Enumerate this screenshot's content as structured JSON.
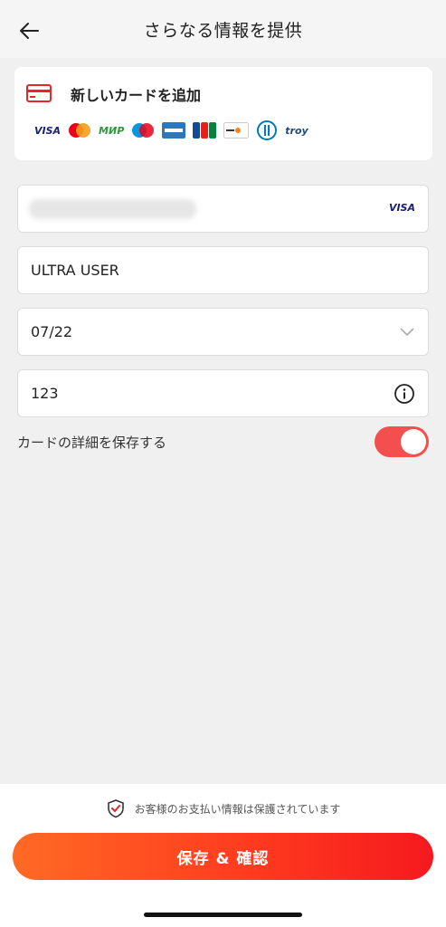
{
  "header": {
    "title": "さらなる情報を提供",
    "back_icon": "arrow-left-icon"
  },
  "card_section": {
    "title": "新しいカードを追加",
    "icon": "credit-card-icon",
    "brands": {
      "visa": "VISA",
      "mir": "МИР",
      "jcb": "JCB",
      "discover": "DISCOVER",
      "troy": "troy"
    }
  },
  "form": {
    "card_number_brand": "VISA",
    "cardholder_name": "ULTRA USER",
    "expiry": "07/22",
    "cvv": "123"
  },
  "save_card": {
    "label": "カードの詳細を保存する",
    "enabled": true
  },
  "footer": {
    "secure_text": "お客様のお支払い情報は保護されています",
    "confirm_label": "保存 & 確認"
  },
  "colors": {
    "accent": "#f44f4f",
    "button_start": "#ff6a24",
    "button_end": "#f5191f"
  }
}
